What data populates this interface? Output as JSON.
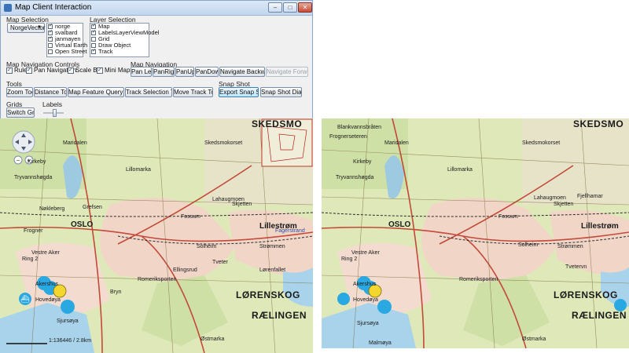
{
  "window": {
    "title": "Map Client Interaction"
  },
  "map_selection": {
    "label": "Map Selection",
    "combo_value": "NorgeVector",
    "items": [
      {
        "label": "norge",
        "checked": true
      },
      {
        "label": "svalbard",
        "checked": true
      },
      {
        "label": "janmayen",
        "checked": true
      },
      {
        "label": "Virtual Earth",
        "checked": false
      },
      {
        "label": "Open Street",
        "checked": false
      }
    ]
  },
  "layer_selection": {
    "label": "Layer Selection",
    "items": [
      {
        "label": "Map",
        "checked": true
      },
      {
        "label": "LabelsLayerViewModel",
        "checked": true
      },
      {
        "label": "Grid",
        "checked": false
      },
      {
        "label": "Draw Object",
        "checked": false
      },
      {
        "label": "Track",
        "checked": true
      }
    ]
  },
  "nav_controls": {
    "label": "Map Navigation Controls",
    "items": [
      {
        "label": "Ruler",
        "checked": true
      },
      {
        "label": "Pan Navigation",
        "checked": true
      },
      {
        "label": "Scale Bar",
        "checked": true
      },
      {
        "label": "Mini Map",
        "checked": true
      }
    ]
  },
  "map_navigation": {
    "label": "Map Navigation",
    "buttons": [
      "Pan Left",
      "PanRight",
      "PanUp",
      "PanDown",
      "Navigate Backward",
      "Navigate Forward"
    ]
  },
  "tools": {
    "label": "Tools",
    "buttons": [
      "Zoom Tool",
      "Distance Tool",
      "Map Feature Query Tool",
      "Track Selection Tool",
      "Move Track Tool"
    ]
  },
  "snapshot": {
    "label": "Snap Shot",
    "buttons": [
      "Export Snap Shot",
      "Snap Shot Dialog"
    ]
  },
  "grids": {
    "label": "Grids",
    "button": "Switch Grid"
  },
  "labels": {
    "label": "Labels"
  },
  "map_left": {
    "labels": [
      "SKEDSMO",
      "Maridalen",
      "Skedsmokorset",
      "Lillomarka",
      "OSLO",
      "Vestre Aker",
      "Ring 2",
      "Akershus",
      "Hovedøya",
      "Sjursøya",
      "LØRENSKOG",
      "RÆLINGEN",
      "Lillestrøm",
      "Strømmen",
      "Fossum",
      "Lahaugmoen",
      "Skjetten",
      "Grefsen",
      "Romeriksporten",
      "Ellingsrud",
      "Østmarka",
      "Bryn",
      "Frogner",
      "Tryvannshøgda",
      "Kirkeby",
      "Fagerstrand",
      "Nøkleberg",
      "Lørenfallet",
      "Tveter",
      "Solheim"
    ],
    "scale": "1:136446 / 2.8km"
  },
  "map_right": {
    "labels": [
      "Blankvannsbråten",
      "Maridalen",
      "SKEDSMO",
      "Skedsmokorset",
      "Lillomarka",
      "OSLO",
      "Vestre Aker",
      "Ring 2",
      "Akershus",
      "Hovedøya",
      "Sjursøya",
      "LØRENSKOG",
      "RÆLINGEN",
      "Lillestrøm",
      "Strømmen",
      "Fossum",
      "Lahaugmoen",
      "Skjetten",
      "Romeriksporten",
      "Østmarka",
      "Malmøya",
      "Frognerseteren",
      "Kirkeby",
      "Tryvannshøgda",
      "Fjellhamar",
      "Tvetervn",
      "Solheim"
    ]
  }
}
